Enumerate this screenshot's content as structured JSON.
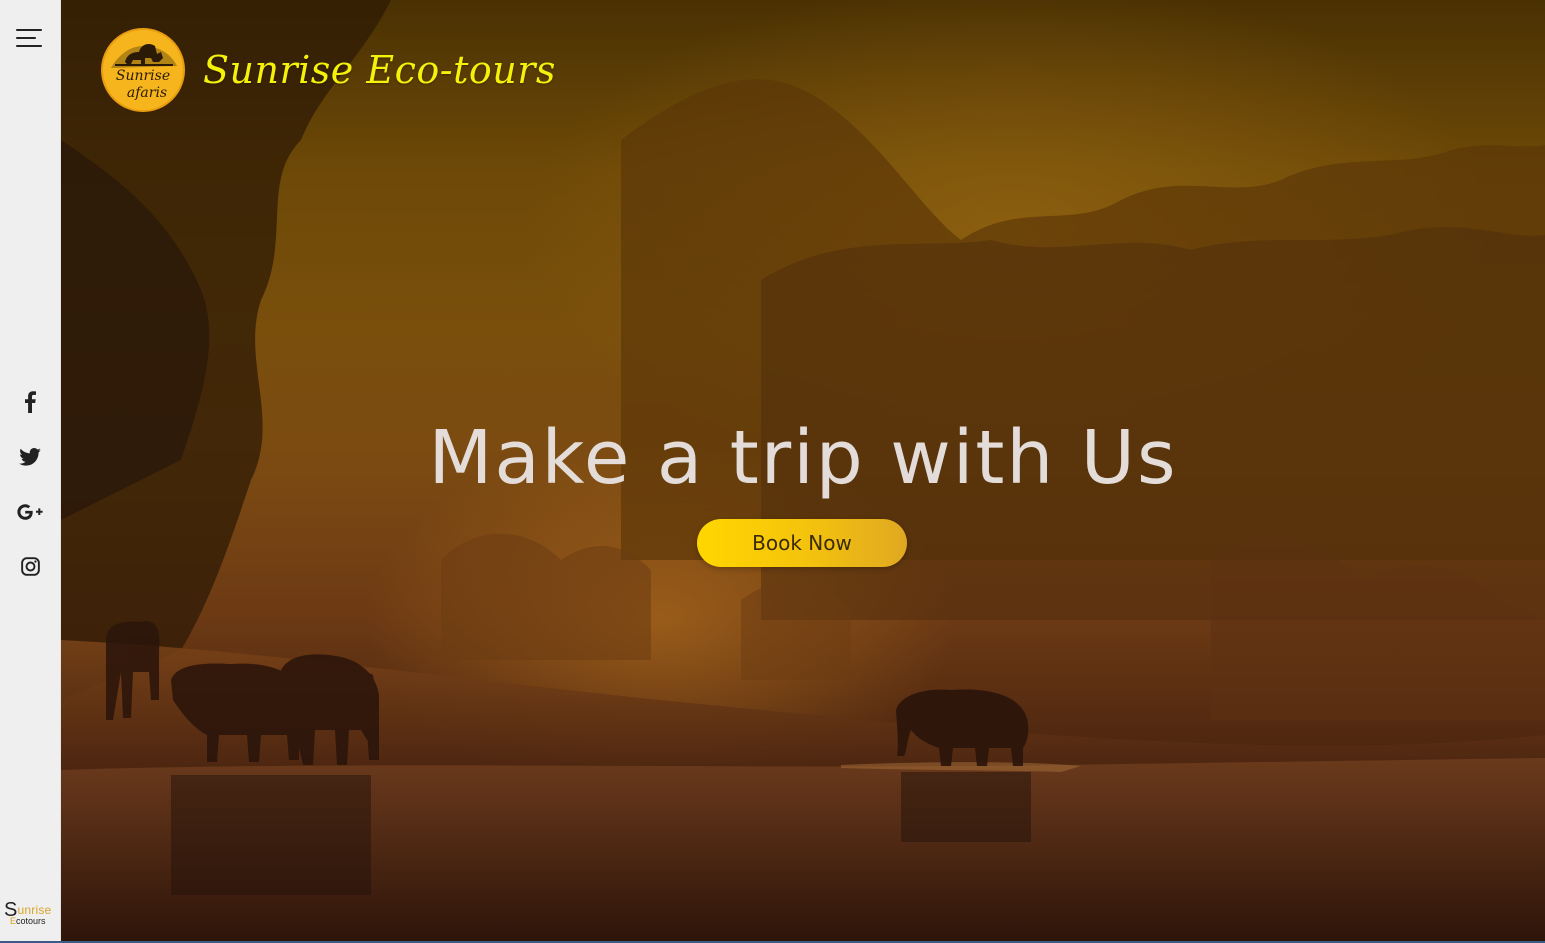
{
  "sidebar": {
    "menu_icon": "hamburger-menu-icon",
    "social": [
      {
        "name": "facebook",
        "icon": "facebook-icon"
      },
      {
        "name": "twitter",
        "icon": "twitter-icon"
      },
      {
        "name": "google-plus",
        "icon": "google-plus-icon"
      },
      {
        "name": "instagram",
        "icon": "instagram-icon"
      }
    ],
    "footer_logo": {
      "big_letter": "S",
      "rest_line1": "unrise",
      "small_letter": "E",
      "rest_line2": "cotours"
    }
  },
  "header": {
    "logo_icon": "sunrise-safaris-logo",
    "logo_text_line1": "Sunrise",
    "logo_text_line2": "afaris",
    "brand_name": "Sunrise Eco-tours"
  },
  "hero": {
    "headline": "Make a trip with Us",
    "cta_label": "Book Now"
  },
  "colors": {
    "brand_yellow": "#f4f10a",
    "button_yellow": "#ffd600",
    "sidebar_bg": "#efefef",
    "headline_text": "#e3dcd8"
  }
}
